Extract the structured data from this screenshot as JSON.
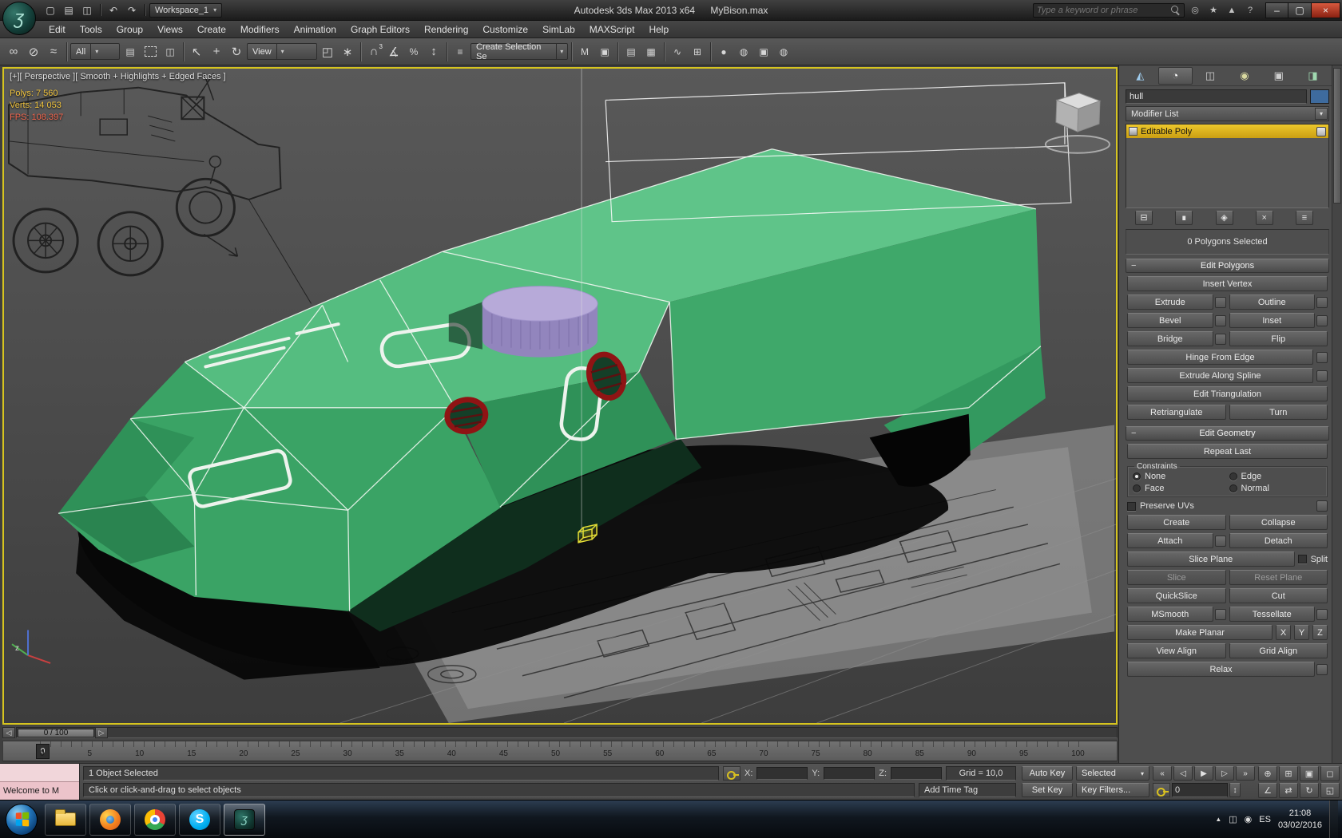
{
  "colors": {
    "viewport_border": "#d6c41f",
    "model_green_top": "#5ec489",
    "model_green_side": "#3aa365",
    "turret_purple": "#9285bd",
    "hatch_ring_red": "#8f1414",
    "stack_highlight": "#e0b41e",
    "listener_pink": "#ecc3ca",
    "object_color_swatch": "#3e6b9e"
  },
  "titlebar": {
    "workspace": "Workspace_1",
    "app_title": "Autodesk 3ds Max 2013 x64",
    "doc_title": "MyBison.max",
    "search_placeholder": "Type a keyword or phrase",
    "icons": {
      "new": "▢",
      "open": "▤",
      "save": "◫",
      "undo": "↶",
      "redo": "↷",
      "comm": "◎",
      "favorites": "★",
      "updates": "▲",
      "help": "?",
      "min": "–",
      "max": "▢",
      "close": "×",
      "caret": "▾"
    }
  },
  "menubar": {
    "items": [
      "Edit",
      "Tools",
      "Group",
      "Views",
      "Create",
      "Modifiers",
      "Animation",
      "Graph Editors",
      "Rendering",
      "Customize",
      "SimLab",
      "MAXScript",
      "Help"
    ]
  },
  "toolbar": {
    "filter_value": "All",
    "view_value": "View",
    "selection_set_value": "Create Selection Se",
    "snap_badge": "3",
    "icons": {
      "select_link": "∞",
      "unlink": "⊘",
      "bind_warp": "≈",
      "select_by_name": "▤",
      "crossing": "◫",
      "select": "↖",
      "move": "+",
      "rotate": "↻",
      "scale": "◰",
      "manipulate": "∗",
      "snap": "∩",
      "angle_snap": "∡",
      "percent_snap": "%",
      "spinner_snap": "↕",
      "named_sets": "≡",
      "mirror": "M",
      "align": "▣",
      "layers": "▤",
      "ribbon": "▦",
      "curve_editor": "∿",
      "schematic": "⊞",
      "material": "●",
      "render_setup": "◍",
      "render_frame": "▣",
      "render": "◍"
    }
  },
  "viewport": {
    "label": "[+][ Perspective ][ Smooth + Highlights + Edged Faces ]",
    "stats": [
      "Polys: 7 560",
      "Verts: 14 053",
      "FPS: 108.397"
    ],
    "axis_z": "z"
  },
  "timeline": {
    "slider_value": "0 / 100",
    "current": "0",
    "ticks": [
      "0",
      "5",
      "10",
      "15",
      "20",
      "25",
      "30",
      "35",
      "40",
      "45",
      "50",
      "55",
      "60",
      "65",
      "70",
      "75",
      "80",
      "85",
      "90",
      "95",
      "100"
    ]
  },
  "command_panel": {
    "tabs": {
      "create": "◭",
      "modify": "◔",
      "hierarchy": "◫",
      "motion": "◉",
      "display": "▣",
      "utilities": "◨"
    },
    "object_name": "hull",
    "modifier_list": "Modifier List",
    "stack_items": [
      "Editable Poly"
    ],
    "stack_tools": {
      "pin": "⊟",
      "show_end": "∎",
      "unique": "◈",
      "remove": "×",
      "sets": "≡"
    },
    "selection_status": "0 Polygons Selected",
    "edit_polygons": {
      "title": "Edit Polygons",
      "insert_vertex": "Insert Vertex",
      "extrude": "Extrude",
      "outline": "Outline",
      "bevel": "Bevel",
      "inset": "Inset",
      "bridge": "Bridge",
      "flip": "Flip",
      "hinge": "Hinge From Edge",
      "extrude_spline": "Extrude Along Spline",
      "edit_tri": "Edit Triangulation",
      "retriangulate": "Retriangulate",
      "turn": "Turn"
    },
    "edit_geometry": {
      "title": "Edit Geometry",
      "repeat_last": "Repeat Last",
      "constraints": "Constraints",
      "none": "None",
      "edge": "Edge",
      "face": "Face",
      "normal": "Normal",
      "preserve_uvs": "Preserve UVs",
      "create": "Create",
      "collapse": "Collapse",
      "attach": "Attach",
      "detach": "Detach",
      "slice_plane": "Slice Plane",
      "split": "Split",
      "slice": "Slice",
      "reset_plane": "Reset Plane",
      "quickslice": "QuickSlice",
      "cut": "Cut",
      "msmooth": "MSmooth",
      "tessellate": "Tessellate",
      "make_planar": "Make Planar",
      "x": "X",
      "y": "Y",
      "z": "Z",
      "view_align": "View Align",
      "grid_align": "Grid Align",
      "relax": "Relax"
    }
  },
  "statusbar": {
    "listener_text": "Welcome to M",
    "selection": "1 Object Selected",
    "prompt": "Click or click-and-drag to select objects",
    "x_label": "X:",
    "y_label": "Y:",
    "z_label": "Z:",
    "grid": "Grid = 10,0",
    "add_time_tag": "Add Time Tag",
    "auto_key": "Auto Key",
    "set_key": "Set Key",
    "selected_filter": "Selected",
    "key_filters": "Key Filters...",
    "time_field": "0",
    "transport": {
      "go_start": "«",
      "prev": "◁",
      "play": "▶",
      "next": "▷",
      "go_end": "»"
    },
    "nav": {
      "zoom": "⊕",
      "zoom_all": "⊞",
      "extents": "▣",
      "extents_all": "◻",
      "fov": "∠",
      "pan": "⇄",
      "orbit": "↻",
      "maximize": "◱"
    }
  },
  "taskbar": {
    "language": "ES",
    "time": "21:08",
    "date": "03/02/2016",
    "apps": [
      "windows-explorer",
      "firefox",
      "chrome",
      "skype",
      "3ds-max"
    ],
    "tray_icons": {
      "hidden": "▲",
      "a": "◫",
      "b": "◉"
    }
  }
}
